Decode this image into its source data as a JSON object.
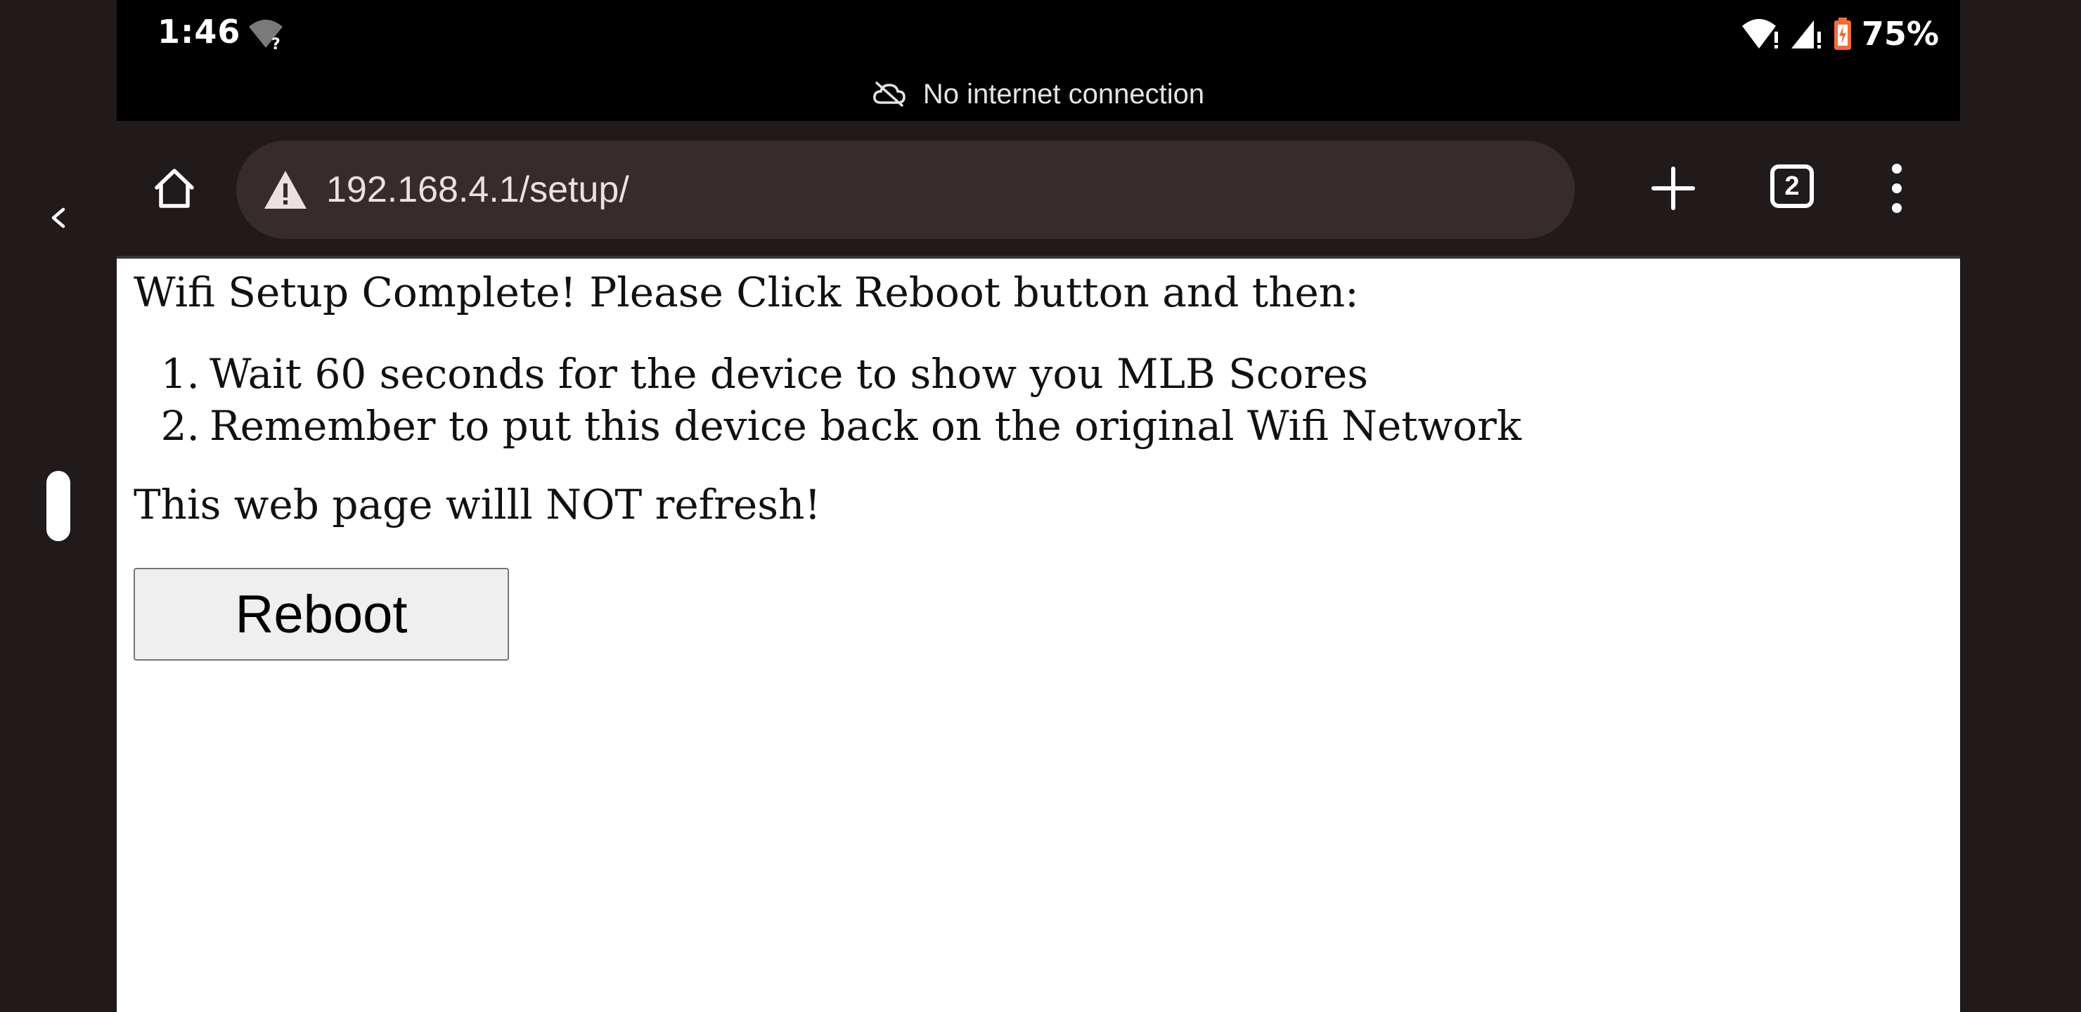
{
  "status_bar": {
    "time": "1:46",
    "battery_percent": "75%",
    "icons": [
      "wifi-question-icon",
      "wifi-warning-icon",
      "signal-warning-icon",
      "battery-charging-icon"
    ]
  },
  "offline_banner": {
    "text": "No internet connection",
    "icon": "cloud-off-icon"
  },
  "toolbar": {
    "url": "192.168.4.1/setup/",
    "tab_count": "2",
    "icons": [
      "home-icon",
      "warning-icon",
      "plus-icon",
      "tabs-icon",
      "more-vert-icon"
    ]
  },
  "page": {
    "intro": "Wifi Setup Complete! Please Click Reboot button and then:",
    "steps": [
      {
        "num": "1.",
        "text": "Wait 60 seconds for the device to show you MLB Scores"
      },
      {
        "num": "2.",
        "text": "Remember to put this device back on the original Wifi Network"
      }
    ],
    "notice": "This web page willl NOT refresh!",
    "reboot_label": "Reboot"
  },
  "colors": {
    "chrome_bg": "#201a1a",
    "omnibox_bg": "#372c2c",
    "status_bg": "#000000",
    "battery_accent": "#f26b3a",
    "page_bg": "#ffffff"
  }
}
